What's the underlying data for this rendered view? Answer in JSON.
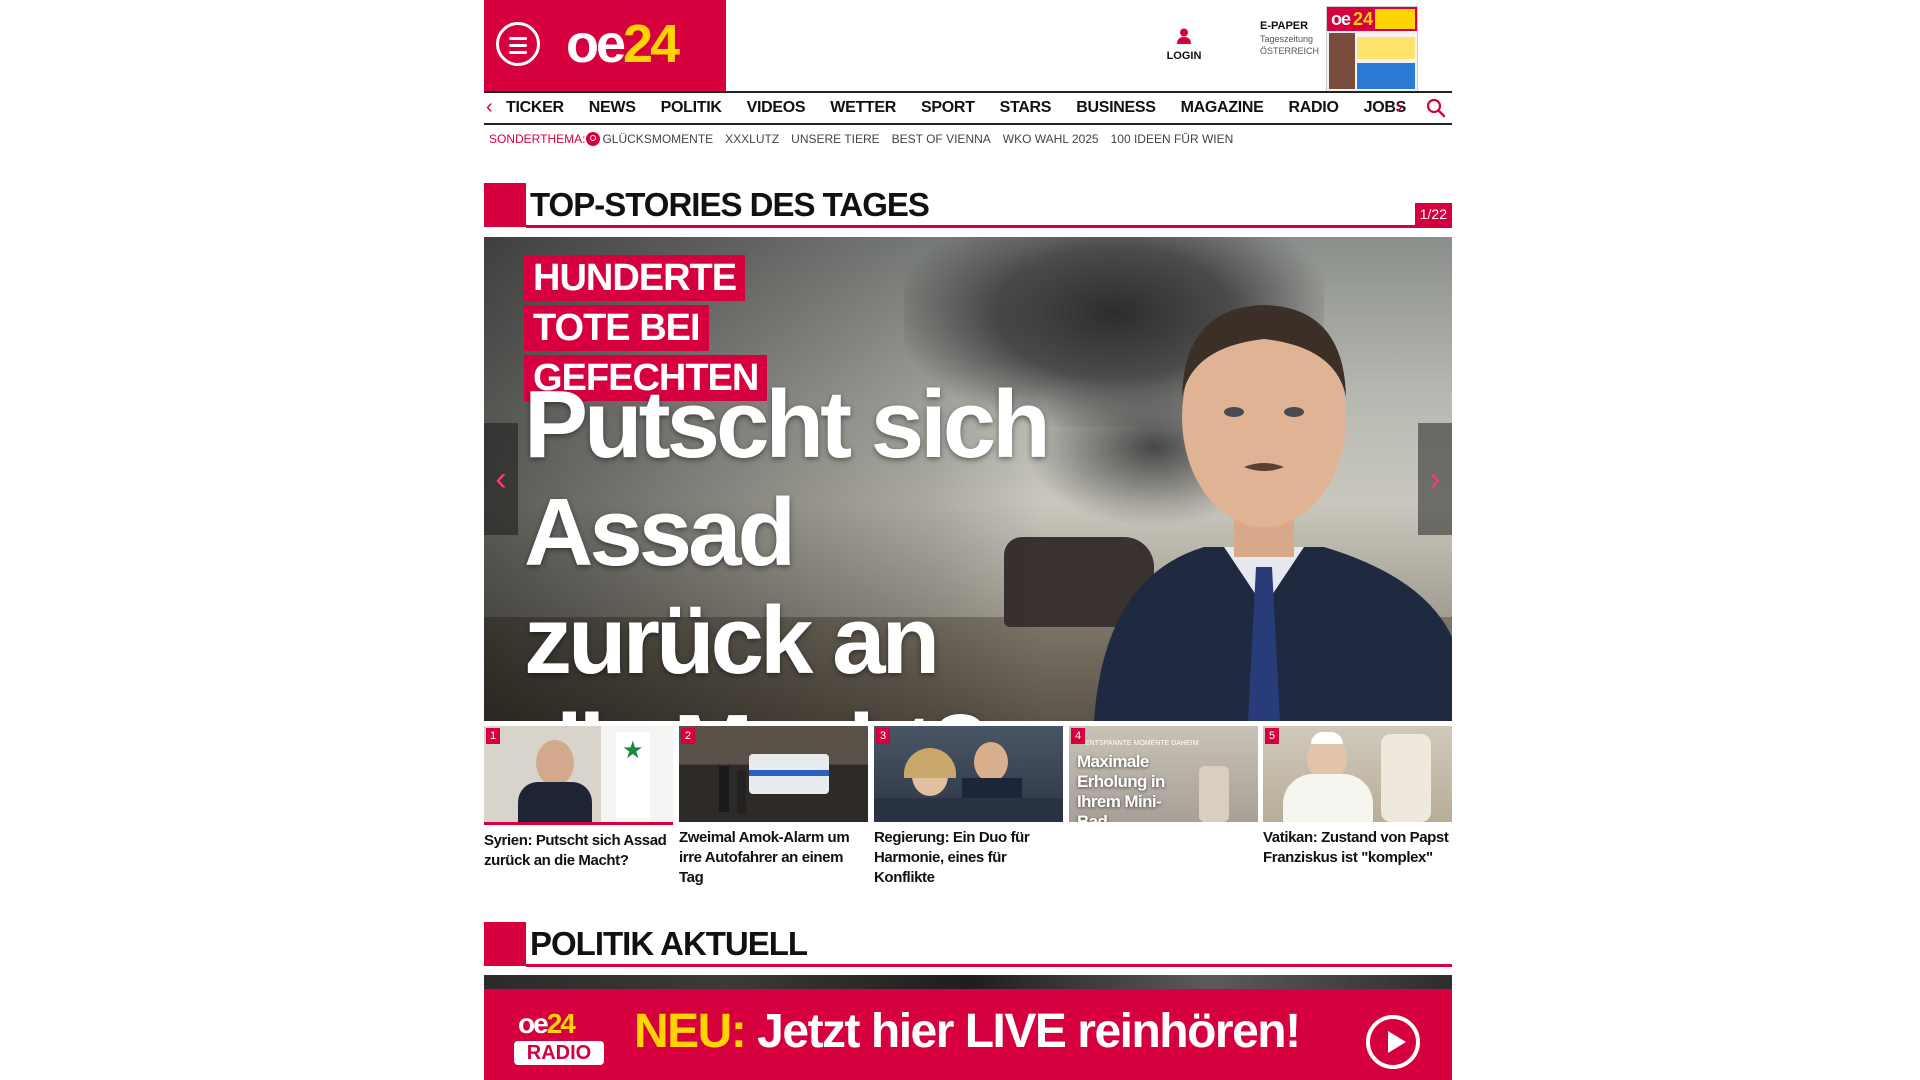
{
  "header": {
    "logo": {
      "part1": "oe",
      "part2": "24"
    },
    "login_label": "LOGIN",
    "epaper": {
      "title": "E-PAPER",
      "subtitle1": "Tageszeitung",
      "subtitle2": "ÖSTERREICH"
    }
  },
  "nav": {
    "items": [
      "TICKER",
      "NEWS",
      "POLITIK",
      "VIDEOS",
      "WETTER",
      "SPORT",
      "STARS",
      "BUSINESS",
      "MAGAZINE",
      "RADIO",
      "JOBS"
    ]
  },
  "subnav": {
    "label": "SONDERTHEMA:",
    "items": [
      "GLÜCKSMOMENTE",
      "XXXLUTZ",
      "UNSERE TIERE",
      "BEST OF VIENNA",
      "WKO WAHL 2025",
      "100 IDEEN FÜR WIEN"
    ]
  },
  "top_stories": {
    "title": "TOP-STORIES DES TAGES",
    "counter": "1/22",
    "hero": {
      "kicker": "HUNDERTE TOTE BEI GEFECHTEN",
      "headline": "Putscht sich Assad zurück an die Macht?"
    },
    "thumbs": [
      {
        "num": "1",
        "caption": "Syrien: Putscht sich Assad zurück an die Macht?"
      },
      {
        "num": "2",
        "caption": "Zweimal Amok-Alarm um irre Autofahrer an einem Tag"
      },
      {
        "num": "3",
        "caption": "Regierung: Ein Duo für Harmonie, eines für Konflikte"
      },
      {
        "num": "4",
        "caption": "",
        "overlay_top": "ENTSPANNTE MOMENTE DAHEIM",
        "overlay_text": "Maximale Erholung in Ihrem Mini-Bad"
      },
      {
        "num": "5",
        "caption": "Vatikan: Zustand von Papst Franziskus ist \"komplex\""
      }
    ]
  },
  "politik": {
    "title": "POLITIK AKTUELL"
  },
  "radio_banner": {
    "logo_top1": "oe",
    "logo_top2": "24",
    "logo_bottom": "RADIO",
    "neu": "NEU:",
    "text": "Jetzt hier LIVE reinhören!"
  },
  "colors": {
    "brand_red": "#d6003e",
    "brand_yellow": "#ffd400"
  }
}
